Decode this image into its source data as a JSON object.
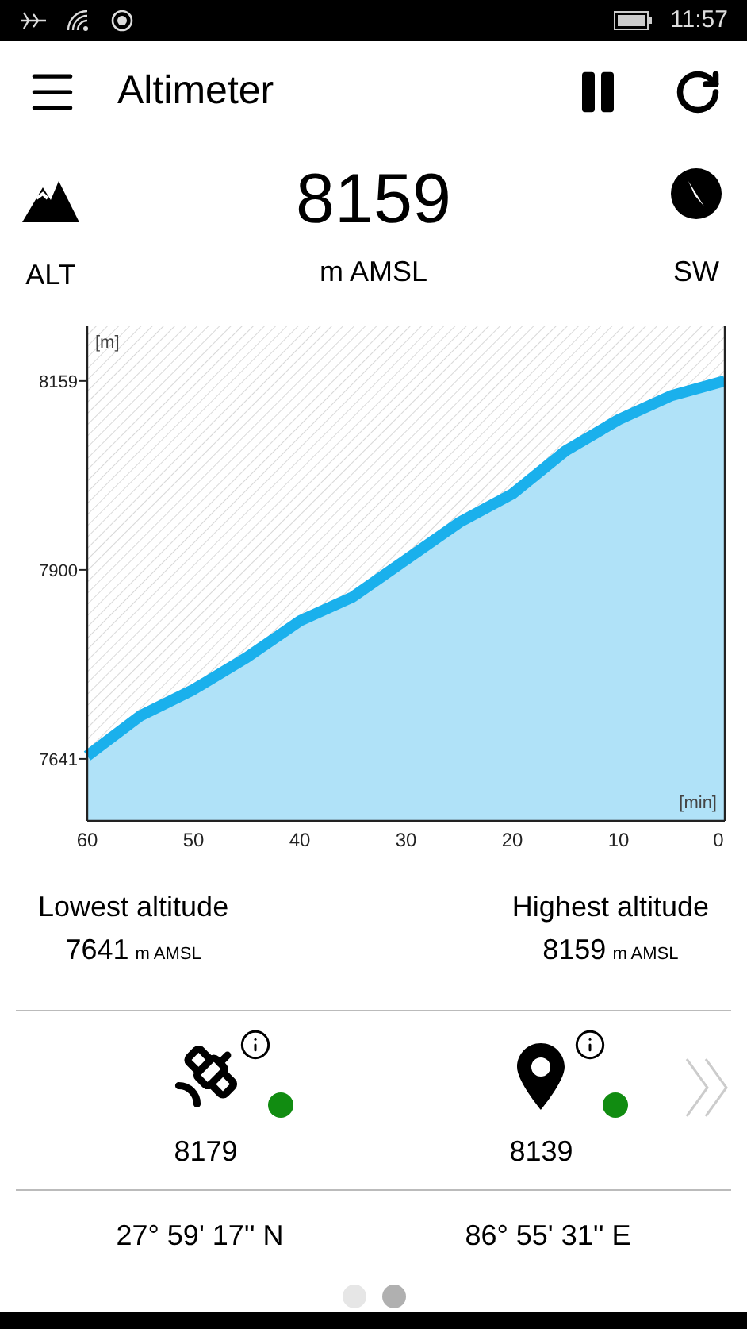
{
  "status_bar": {
    "time": "11:57"
  },
  "header": {
    "title": "Altimeter"
  },
  "current": {
    "value": "8159",
    "unit": "m AMSL",
    "left_label": "ALT",
    "right_label": "SW"
  },
  "chart_data": {
    "type": "area",
    "xlabel": "[min]",
    "ylabel": "[m]",
    "x": [
      60,
      55,
      50,
      45,
      40,
      35,
      30,
      25,
      20,
      15,
      10,
      5,
      0
    ],
    "series": [
      {
        "color": "#1ab0ec",
        "values": [
          7645,
          7700,
          7736,
          7780,
          7830,
          7863,
          7914,
          7965,
          8004,
          8063,
          8106,
          8139,
          8159
        ]
      }
    ],
    "xlim": [
      60,
      0
    ],
    "ylim": [
      7556,
      8235
    ],
    "xticks": [
      60,
      50,
      40,
      30,
      20,
      10,
      0
    ],
    "yticks": [
      7641,
      7900,
      8159
    ]
  },
  "stats": [
    {
      "label": "Lowest altitude",
      "value": "7641",
      "unit": "m AMSL"
    },
    {
      "label": "Highest altitude",
      "value": "8159",
      "unit": "m AMSL"
    }
  ],
  "sensors": [
    {
      "kind": "satellite",
      "value": "8179",
      "color": "#118c11"
    },
    {
      "kind": "location",
      "value": "8139",
      "color": "#118c11"
    }
  ],
  "coordinates": [
    "27° 59' 17'' N",
    "86° 55' 31'' E"
  ],
  "pager": [
    {
      "selected": false
    },
    {
      "selected": true
    }
  ]
}
